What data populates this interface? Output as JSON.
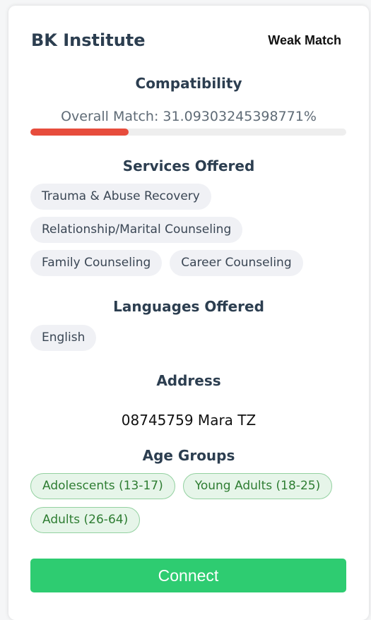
{
  "provider": {
    "name": "BK Institute",
    "match_label": "Weak Match"
  },
  "compatibility": {
    "title": "Compatibility",
    "text": "Overall Match: 31.09303245398771%",
    "percent": 31.09303245398771,
    "bar_color": "#e74c3c"
  },
  "services": {
    "title": "Services Offered",
    "items": [
      "Trauma & Abuse Recovery",
      "Relationship/Marital Counseling",
      "Family Counseling",
      "Career Counseling"
    ]
  },
  "languages": {
    "title": "Languages Offered",
    "items": [
      "English"
    ]
  },
  "address": {
    "title": "Address",
    "value": "08745759 Mara TZ"
  },
  "age_groups": {
    "title": "Age Groups",
    "items": [
      "Adolescents (13-17)",
      "Young Adults (18-25)",
      "Adults (26-64)"
    ]
  },
  "actions": {
    "connect_label": "Connect",
    "connect_color": "#2ecc71"
  }
}
